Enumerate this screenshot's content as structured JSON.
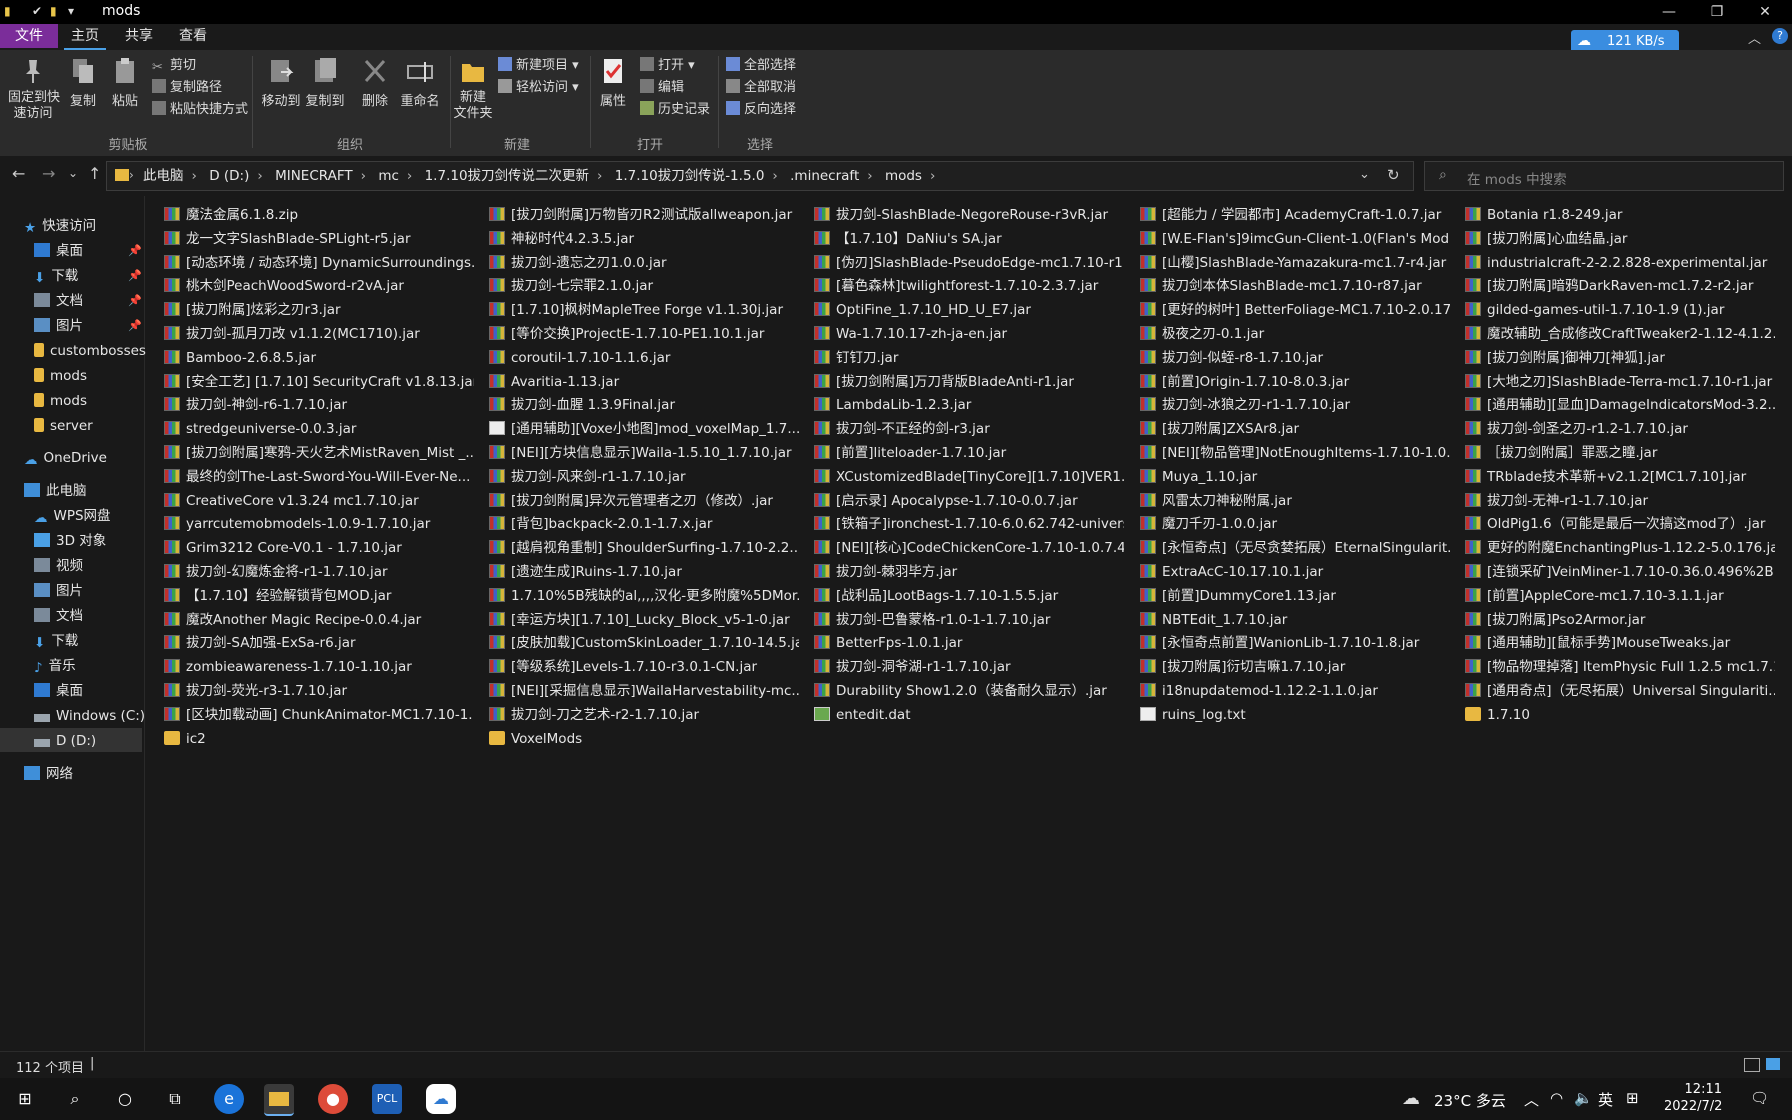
{
  "window": {
    "title": "mods",
    "controls": [
      "—",
      "❐",
      "✕"
    ]
  },
  "ribbon_tabs": [
    "文件",
    "主页",
    "共享",
    "查看"
  ],
  "speed_badge": "121 KB/s",
  "ribbon": {
    "clipboard": {
      "pin": "固定到快\n速访问",
      "copy": "复制",
      "paste": "粘贴",
      "cut": "剪切",
      "copy_path": "复制路径",
      "paste_shortcut": "粘贴快捷方式",
      "label": "剪贴板"
    },
    "organize": {
      "move_to": "移动到",
      "copy_to": "复制到",
      "delete": "删除",
      "rename": "重命名",
      "label": "组织"
    },
    "new": {
      "new_folder": "新建\n文件夹",
      "new_item": "新建项目",
      "easy_access": "轻松访问",
      "label": "新建"
    },
    "open": {
      "properties": "属性",
      "open": "打开",
      "edit": "编辑",
      "history": "历史记录",
      "label": "打开"
    },
    "select": {
      "select_all": "全部选择",
      "select_none": "全部取消",
      "invert": "反向选择",
      "label": "选择"
    }
  },
  "breadcrumbs": [
    "此电脑",
    "D (D:)",
    "MINECRAFT",
    "mc",
    "1.7.10拔刀剑传说二次更新",
    "1.7.10拔刀剑传说-1.5.0",
    ".minecraft",
    "mods"
  ],
  "search_placeholder": "在 mods 中搜索",
  "nav": {
    "quick_access": "快速访问",
    "quick_items": [
      "桌面",
      "下载",
      "文档",
      "图片",
      "custombosses",
      "mods",
      "mods",
      "server"
    ],
    "onedrive": "OneDrive",
    "this_pc": "此电脑",
    "pc_items": [
      "WPS网盘",
      "3D 对象",
      "视频",
      "图片",
      "文档",
      "下载",
      "音乐",
      "桌面",
      "Windows (C:)",
      "D (D:)"
    ],
    "network": "网络"
  },
  "files": [
    {
      "name": "魔法金属6.1.8.zip",
      "type": "jar"
    },
    {
      "name": "龙一文字SlashBlade-SPLight-r5.jar",
      "type": "jar"
    },
    {
      "name": "[动态环境 / 动态环境] DynamicSurroundings...",
      "type": "jar"
    },
    {
      "name": "桃木剑PeachWoodSword-r2vA.jar",
      "type": "jar"
    },
    {
      "name": "[拔刀附属]炫彩之刃r3.jar",
      "type": "jar"
    },
    {
      "name": "拔刀剑-孤月刀改 v1.1.2(MC1710).jar",
      "type": "jar"
    },
    {
      "name": "Bamboo-2.6.8.5.jar",
      "type": "jar"
    },
    {
      "name": "[安全工艺] [1.7.10] SecurityCraft v1.8.13.jar",
      "type": "jar"
    },
    {
      "name": "拔刀剑-神剑-r6-1.7.10.jar",
      "type": "jar"
    },
    {
      "name": "stredgeuniverse-0.0.3.jar",
      "type": "jar"
    },
    {
      "name": "[拔刀剑附属]寒鸦-天火艺术MistRaven_Mist _...",
      "type": "jar"
    },
    {
      "name": "最终的剑The-Last-Sword-You-Will-Ever-Ne...",
      "type": "jar"
    },
    {
      "name": "CreativeCore v1.3.24 mc1.7.10.jar",
      "type": "jar"
    },
    {
      "name": "yarrcutemobmodels-1.0.9-1.7.10.jar",
      "type": "jar"
    },
    {
      "name": "Grim3212 Core-V0.1 - 1.7.10.jar",
      "type": "jar"
    },
    {
      "name": "拔刀剑-幻魔炼金将-r1-1.7.10.jar",
      "type": "jar"
    },
    {
      "name": "【1.7.10】经验解锁背包MOD.jar",
      "type": "jar"
    },
    {
      "name": "魔改Another Magic Recipe-0.0.4.jar",
      "type": "jar"
    },
    {
      "name": "拔刀剑-SA加强-ExSa-r6.jar",
      "type": "jar"
    },
    {
      "name": "zombieawareness-1.7.10-1.10.jar",
      "type": "jar"
    },
    {
      "name": "拔刀剑-荧光-r3-1.7.10.jar",
      "type": "jar"
    },
    {
      "name": "[区块加载动画] ChunkAnimator-MC1.7.10-1...",
      "type": "jar"
    },
    {
      "name": "ic2",
      "type": "folder"
    },
    {
      "name": "[拔刀剑附属]万物皆刃R2测试版allweapon.jar",
      "type": "jar"
    },
    {
      "name": "神秘时代4.2.3.5.jar",
      "type": "jar"
    },
    {
      "name": "拔刀剑-遗忘之刃1.0.0.jar",
      "type": "jar"
    },
    {
      "name": "拔刀剑-七宗罪2.1.0.jar",
      "type": "jar"
    },
    {
      "name": "[1.7.10]枫树MapleTree Forge v1.1.30j.jar",
      "type": "jar"
    },
    {
      "name": "[等价交换]ProjectE-1.7.10-PE1.10.1.jar",
      "type": "jar"
    },
    {
      "name": "coroutil-1.7.10-1.1.6.jar",
      "type": "jar"
    },
    {
      "name": "Avaritia-1.13.jar",
      "type": "jar"
    },
    {
      "name": "拔刀剑-血腥 1.3.9Final.jar",
      "type": "jar"
    },
    {
      "name": "[通用辅助][Voxe小地图]mod_voxelMap_1.7....",
      "type": "txt"
    },
    {
      "name": "[NEI][方块信息显示]Waila-1.5.10_1.7.10.jar",
      "type": "jar"
    },
    {
      "name": "拔刀剑-风来剑-r1-1.7.10.jar",
      "type": "jar"
    },
    {
      "name": "[拔刀剑附属]异次元管理者之刃（修改）.jar",
      "type": "jar"
    },
    {
      "name": "[背包]backpack-2.0.1-1.7.x.jar",
      "type": "jar"
    },
    {
      "name": "[越肩视角重制] ShoulderSurfing-1.7.10-2.2....",
      "type": "jar"
    },
    {
      "name": "[遗迹生成]Ruins-1.7.10.jar",
      "type": "jar"
    },
    {
      "name": "1.7.10%5B残缺的al,,,,汉化-更多附魔%5DMor...",
      "type": "jar"
    },
    {
      "name": "[幸运方块][1.7.10]_Lucky_Block_v5-1-0.jar",
      "type": "jar"
    },
    {
      "name": "[皮肤加载]CustomSkinLoader_1.7.10-14.5.jar",
      "type": "jar"
    },
    {
      "name": "[等级系统]Levels-1.7.10-r3.0.1-CN.jar",
      "type": "jar"
    },
    {
      "name": "[NEI][采掘信息显示]WailaHarvestability-mc...",
      "type": "jar"
    },
    {
      "name": "拔刀剑-刀之艺术-r2-1.7.10.jar",
      "type": "jar"
    },
    {
      "name": "VoxelMods",
      "type": "folder"
    },
    {
      "name": "拔刀剑-SlashBlade-NegoreRouse-r3vR.jar",
      "type": "jar"
    },
    {
      "name": "【1.7.10】DaNiu's SA.jar",
      "type": "jar"
    },
    {
      "name": "[伪刃]SlashBlade-PseudoEdge-mc1.7.10-r1...",
      "type": "jar"
    },
    {
      "name": "[暮色森林]twilightforest-1.7.10-2.3.7.jar",
      "type": "jar"
    },
    {
      "name": "OptiFine_1.7.10_HD_U_E7.jar",
      "type": "jar"
    },
    {
      "name": "Wa-1.7.10.17-zh-ja-en.jar",
      "type": "jar"
    },
    {
      "name": "钉钉刀.jar",
      "type": "jar"
    },
    {
      "name": "[拔刀剑附属]万刀背版BladeAnti-r1.jar",
      "type": "jar"
    },
    {
      "name": "LambdaLib-1.2.3.jar",
      "type": "jar"
    },
    {
      "name": "拔刀剑-不正经的剑-r3.jar",
      "type": "jar"
    },
    {
      "name": "[前置]liteloader-1.7.10.jar",
      "type": "jar"
    },
    {
      "name": "XCustomizedBlade[TinyCore][1.7.10]VER1....",
      "type": "jar"
    },
    {
      "name": "[启示录] Apocalypse-1.7.10-0.0.7.jar",
      "type": "jar"
    },
    {
      "name": "[铁箱子]ironchest-1.7.10-6.0.62.742-univers...",
      "type": "jar"
    },
    {
      "name": "[NEI][核心]CodeChickenCore-1.7.10-1.0.7.4...",
      "type": "jar"
    },
    {
      "name": "拔刀剑-棘羽毕方.jar",
      "type": "jar"
    },
    {
      "name": "[战利品]LootBags-1.7.10-1.5.5.jar",
      "type": "jar"
    },
    {
      "name": "拔刀剑-巴鲁蒙格-r1.0-1-1.7.10.jar",
      "type": "jar"
    },
    {
      "name": "BetterFps-1.0.1.jar",
      "type": "jar"
    },
    {
      "name": "拔刀剑-洞爷湖-r1-1.7.10.jar",
      "type": "jar"
    },
    {
      "name": "Durability Show1.2.0（装备耐久显示）.jar",
      "type": "jar"
    },
    {
      "name": "entedit.dat",
      "type": "dat"
    },
    {
      "name": "[超能力 / 学园都市] AcademyCraft-1.0.7.jar",
      "type": "jar"
    },
    {
      "name": "[W.E-Flan's]9imcGun-Client-1.0(Flan's Mod...",
      "type": "jar"
    },
    {
      "name": "[山樱]SlashBlade-Yamazakura-mc1.7-r4.jar",
      "type": "jar"
    },
    {
      "name": "拔刀剑本体SlashBlade-mc1.7.10-r87.jar",
      "type": "jar"
    },
    {
      "name": "[更好的树叶] BetterFoliage-MC1.7.10-2.0.17...",
      "type": "jar"
    },
    {
      "name": "极夜之刃-0.1.jar",
      "type": "jar"
    },
    {
      "name": "拔刀剑-似蛭-r8-1.7.10.jar",
      "type": "jar"
    },
    {
      "name": "[前置]Origin-1.7.10-8.0.3.jar",
      "type": "jar"
    },
    {
      "name": "拔刀剑-冰狼之刃-r1-1.7.10.jar",
      "type": "jar"
    },
    {
      "name": "[拔刀附属]ZXSAr8.jar",
      "type": "jar"
    },
    {
      "name": "[NEI][物品管理]NotEnoughItems-1.7.10-1.0....",
      "type": "jar"
    },
    {
      "name": "Muya_1.10.jar",
      "type": "jar"
    },
    {
      "name": "风雷太刀神秘附属.jar",
      "type": "jar"
    },
    {
      "name": "魔刀千刃-1.0.0.jar",
      "type": "jar"
    },
    {
      "name": "[永恒奇点]（无尽贪婪拓展）EternalSingularit...",
      "type": "jar"
    },
    {
      "name": "ExtraAcC-10.17.10.1.jar",
      "type": "jar"
    },
    {
      "name": "[前置]DummyCore1.13.jar",
      "type": "jar"
    },
    {
      "name": "NBTEdit_1.7.10.jar",
      "type": "jar"
    },
    {
      "name": "[永恒奇点前置]WanionLib-1.7.10-1.8.jar",
      "type": "jar"
    },
    {
      "name": "[拔刀附属]衍切吉嘛1.7.10.jar",
      "type": "jar"
    },
    {
      "name": "i18nupdatemod-1.12.2-1.1.0.jar",
      "type": "jar"
    },
    {
      "name": "ruins_log.txt",
      "type": "txt"
    },
    {
      "name": "Botania r1.8-249.jar",
      "type": "jar"
    },
    {
      "name": "[拔刀附属]心血结晶.jar",
      "type": "jar"
    },
    {
      "name": "industrialcraft-2-2.2.828-experimental.jar",
      "type": "jar"
    },
    {
      "name": "[拔刀附属]暗鸦DarkRaven-mc1.7.2-r2.jar",
      "type": "jar"
    },
    {
      "name": "gilded-games-util-1.7.10-1.9 (1).jar",
      "type": "jar"
    },
    {
      "name": "魔改辅助_合成修改CraftTweaker2-1.12-4.1.2....",
      "type": "jar"
    },
    {
      "name": "[拔刀剑附属]御神刀[神狐].jar",
      "type": "jar"
    },
    {
      "name": "[大地之刃]SlashBlade-Terra-mc1.7.10-r1.jar",
      "type": "jar"
    },
    {
      "name": "[通用辅助][显血]DamageIndicatorsMod-3.2....",
      "type": "jar"
    },
    {
      "name": "拔刀剑-剑圣之刃-r1.2-1.7.10.jar",
      "type": "jar"
    },
    {
      "name": "［拔刀剑附属］罪恶之瞳.jar",
      "type": "jar"
    },
    {
      "name": "TRblade技术革新+v2.1.2[MC1.7.10].jar",
      "type": "jar"
    },
    {
      "name": "拔刀剑-无神-r1-1.7.10.jar",
      "type": "jar"
    },
    {
      "name": "OldPig1.6（可能是最后一次搞这mod了）.jar",
      "type": "jar"
    },
    {
      "name": "更好的附魔EnchantingPlus-1.12.2-5.0.176.jar",
      "type": "jar"
    },
    {
      "name": "[连锁采矿]VeinMiner-1.7.10-0.36.0.496%2B...",
      "type": "jar"
    },
    {
      "name": "[前置]AppleCore-mc1.7.10-3.1.1.jar",
      "type": "jar"
    },
    {
      "name": "[拔刀附属]Pso2Armor.jar",
      "type": "jar"
    },
    {
      "name": "[通用辅助][鼠标手势]MouseTweaks.jar",
      "type": "jar"
    },
    {
      "name": "[物品物理掉落] ItemPhysic Full 1.2.5 mc1.7.1...",
      "type": "jar"
    },
    {
      "name": "[通用奇点]（无尽拓展）Universal Singulariti...",
      "type": "jar"
    },
    {
      "name": "1.7.10",
      "type": "folder"
    }
  ],
  "status": {
    "count": "112 个项目"
  },
  "taskbar": {
    "weather": "23°C 多云",
    "ime": "英",
    "time": "12:11",
    "date": "2022/7/2",
    "pcl": "PCL"
  }
}
